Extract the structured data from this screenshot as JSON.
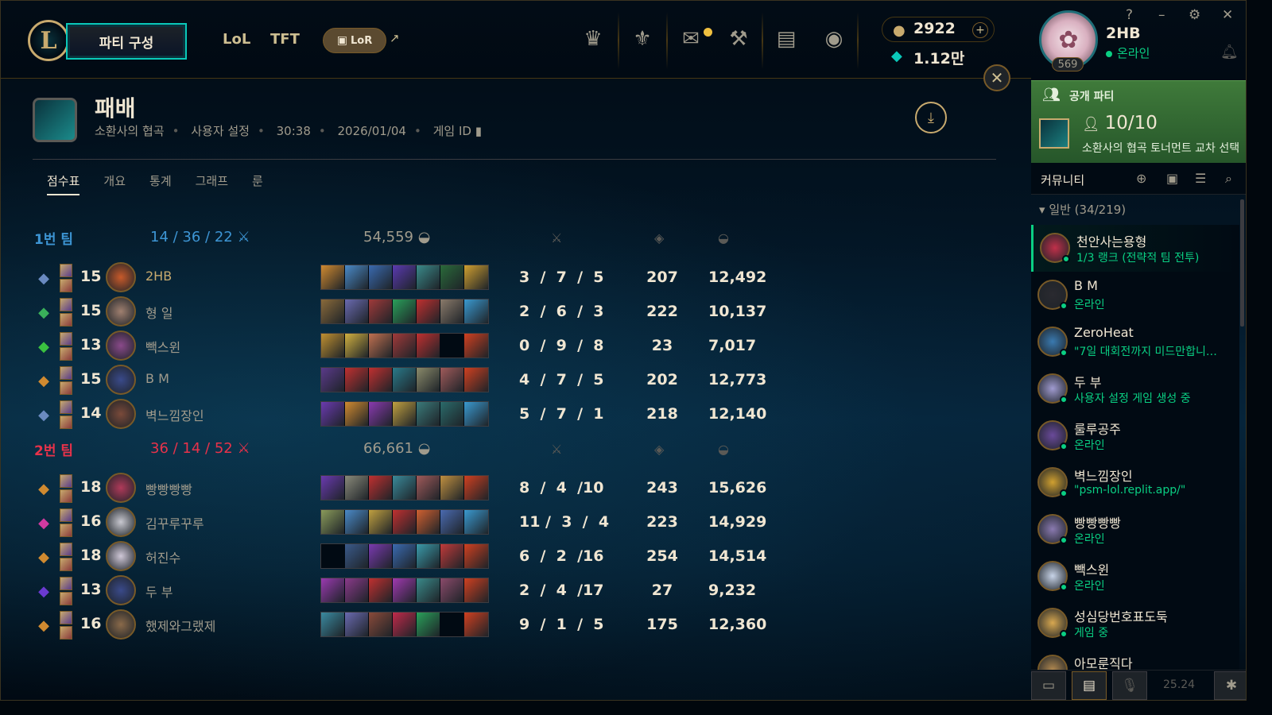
{
  "colors": {
    "blue_team": "#3d95d4",
    "red_team": "#e8324a",
    "gold": "#c8aa6e",
    "online_green": "#0acf83",
    "party_green": "#3f7a3a"
  },
  "topnav": {
    "play_label": "파티 구성",
    "lol_label": "LoL",
    "tft_label": "TFT",
    "lor_label": "LoR",
    "ext_arrow": "↗",
    "rp_value": "2922",
    "be_value": "1.12만",
    "plus": "+",
    "close": "✕",
    "icons": [
      "worlds-trophy-icon",
      "tft-crest-icon",
      "mail-icon",
      "crafting-icon",
      "collection-icon",
      "loot-icon"
    ]
  },
  "profile": {
    "name": "2HB",
    "level": "569",
    "status": "온라인",
    "help": "?",
    "minimize": "–",
    "settings": "⚙",
    "close": "✕"
  },
  "party": {
    "title": "공개 파티",
    "count": "10/10",
    "mode": "소환사의 협곡 토너먼트 교차 선택"
  },
  "community": {
    "title": "커뮤니티",
    "group": "일반 (34/219)",
    "friends": [
      {
        "name": "천안사는용형",
        "status": "1/3 랭크 (전략적 팀 전투)",
        "color": "#c0304a",
        "selected": true
      },
      {
        "name": "B M",
        "status": "온라인",
        "color": "#2a2a30",
        "selected": false
      },
      {
        "name": "ZeroHeat",
        "status": "\"7일 대회전까지 미드만합니…",
        "color": "#3a7ab0",
        "selected": false
      },
      {
        "name": "두 부",
        "status": "사용자 설정 게임 생성 중",
        "color": "#a09bd0",
        "selected": false
      },
      {
        "name": "룰루공주",
        "status": "온라인",
        "color": "#6a4a9a",
        "selected": false
      },
      {
        "name": "벽느낌장인",
        "status": "\"psm-lol.replit.app/\"",
        "color": "#d0a030",
        "selected": false
      },
      {
        "name": "빵빵빵빵",
        "status": "온라인",
        "color": "#8a7ab0",
        "selected": false
      },
      {
        "name": "빽스윈",
        "status": "온라인",
        "color": "#c8d4e8",
        "selected": false
      },
      {
        "name": "성심당번호표도둑",
        "status": "게임 중",
        "color": "#d8a850",
        "selected": false
      },
      {
        "name": "아모룬직다",
        "status": "",
        "color": "#b08850",
        "selected": false
      }
    ],
    "version": "25.24"
  },
  "match": {
    "result": "패배",
    "mode": "소환사의 협곡",
    "type": "사용자 설정",
    "duration": "30:38",
    "date": "2026/01/04",
    "game_id_label": "게임 ID",
    "tabs": [
      "점수표",
      "개요",
      "통계",
      "그래프",
      "룬"
    ]
  },
  "teams": [
    {
      "label": "1번 팀",
      "k": "14",
      "d": "36",
      "a": "22",
      "gold": "54,559",
      "players": [
        {
          "level": "15",
          "name": "2HB",
          "me": true,
          "kda": "3  /  7  /  5",
          "cs": "207",
          "gold": "12,492",
          "spell_color": "#6a8ac0",
          "champ_color": "#c85a2a",
          "items": [
            "#d08a30",
            "#4a8ac8",
            "#3a6ab0",
            "#5a3ab0",
            "#3a8a8a",
            "#2a6a3a",
            "#d0a030"
          ]
        },
        {
          "level": "15",
          "name": "형 일",
          "me": false,
          "kda": "2  /  6  /  3",
          "cs": "222",
          "gold": "10,137",
          "spell_color": "#3ab05a",
          "champ_color": "#a08070",
          "items": [
            "#8a6a3a",
            "#6a6ab0",
            "#a03a3a",
            "#2aa05a",
            "#c03030",
            "#8a7a6a",
            "#3a9ad0"
          ]
        },
        {
          "level": "13",
          "name": "빽스윈",
          "me": false,
          "kda": "0  /  9  /  8",
          "cs": "23",
          "gold": "7,017",
          "spell_color": "#3ac040",
          "champ_color": "#8a4a8a",
          "items": [
            "#c09030",
            "#d0b040",
            "#c07050",
            "#a03a3a",
            "#c03030",
            "",
            "#d04020"
          ]
        },
        {
          "level": "15",
          "name": "B M",
          "me": false,
          "kda": "4  /  7  /  5",
          "cs": "202",
          "gold": "12,773",
          "spell_color": "#d08a30",
          "champ_color": "#3a4a8a",
          "items": [
            "#5a3a8a",
            "#c03030",
            "#c03030",
            "#2a7a8a",
            "#8a8a6a",
            "#a05a5a",
            "#d04020"
          ]
        },
        {
          "level": "14",
          "name": "벽느낌장인",
          "me": false,
          "kda": "5  /  7  /  1",
          "cs": "218",
          "gold": "12,140",
          "spell_color": "#6a8ac0",
          "champ_color": "#7a4a3a",
          "items": [
            "#6a3ab0",
            "#d08a30",
            "#8a3ab0",
            "#c0a040",
            "#3a7a7a",
            "#2a6a6a",
            "#3a9ad0"
          ]
        }
      ]
    },
    {
      "label": "2번 팀",
      "k": "36",
      "d": "14",
      "a": "52",
      "gold": "66,661",
      "players": [
        {
          "level": "18",
          "name": "빵빵빵빵",
          "me": false,
          "kda": "8  /  4  /10",
          "cs": "243",
          "gold": "15,626",
          "spell_color": "#d08a30",
          "champ_color": "#b03a5a",
          "items": [
            "#6a3ab0",
            "#8a8a7a",
            "#c03030",
            "#3a8a9a",
            "#a05a5a",
            "#c09040",
            "#d04020"
          ]
        },
        {
          "level": "16",
          "name": "김꾸루꾸루",
          "me": false,
          "kda": "11 /  3  /  4",
          "cs": "223",
          "gold": "14,929",
          "spell_color": "#d03aa0",
          "champ_color": "#c8c8d0",
          "items": [
            "#8a9a5a",
            "#4a8ac8",
            "#c0a040",
            "#c03030",
            "#d06030",
            "#4a6ab0",
            "#3a9ad0"
          ]
        },
        {
          "level": "18",
          "name": "허진수",
          "me": false,
          "kda": "6  /  2  /16",
          "cs": "254",
          "gold": "14,514",
          "spell_color": "#d08a30",
          "champ_color": "#d0c8d8",
          "items": [
            "",
            "#3a5a8a",
            "#7a3ab0",
            "#3a6ab0",
            "#3a9aaa",
            "#c03a3a",
            "#d04020"
          ]
        },
        {
          "level": "13",
          "name": "두 부",
          "me": false,
          "kda": "2  /  4  /17",
          "cs": "27",
          "gold": "9,232",
          "spell_color": "#6a3ad0",
          "champ_color": "#3a4a8a",
          "items": [
            "#9a3ab0",
            "#8a3a8a",
            "#c03030",
            "#a03ab0",
            "#3a8a8a",
            "#8a4a6a",
            "#d04020"
          ]
        },
        {
          "level": "16",
          "name": "했제와그랬제",
          "me": false,
          "kda": "9  /  1  /  5",
          "cs": "175",
          "gold": "12,360",
          "spell_color": "#d08a30",
          "champ_color": "#8a6a4a",
          "items": [
            "#3a8aa0",
            "#6a6ab0",
            "#8a4a3a",
            "#c02a4a",
            "#2aa05a",
            "",
            "#d04020"
          ]
        }
      ]
    }
  ]
}
